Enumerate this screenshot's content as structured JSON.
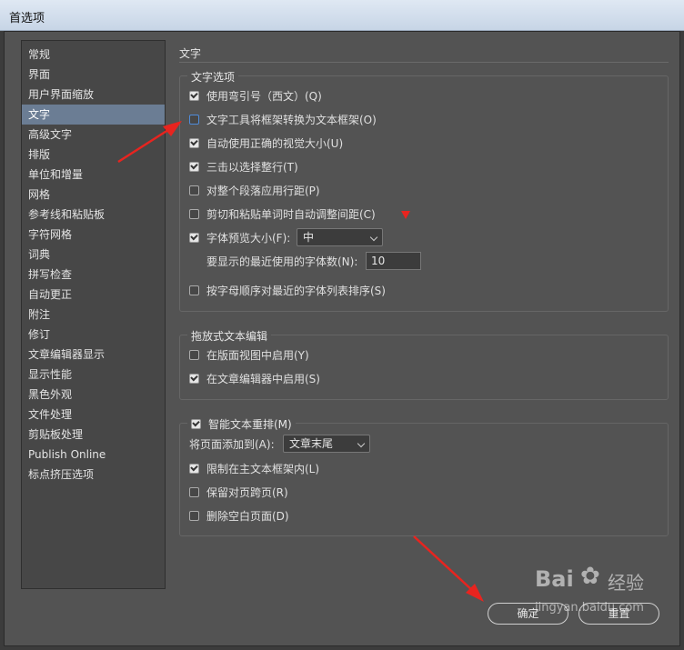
{
  "window": {
    "title": "首选项"
  },
  "sidebar": {
    "items": [
      {
        "label": "常规"
      },
      {
        "label": "界面"
      },
      {
        "label": "用户界面缩放"
      },
      {
        "label": "文字"
      },
      {
        "label": "高级文字"
      },
      {
        "label": "排版"
      },
      {
        "label": "单位和增量"
      },
      {
        "label": "网格"
      },
      {
        "label": "参考线和粘贴板"
      },
      {
        "label": "字符网格"
      },
      {
        "label": "词典"
      },
      {
        "label": "拼写检查"
      },
      {
        "label": "自动更正"
      },
      {
        "label": "附注"
      },
      {
        "label": "修订"
      },
      {
        "label": "文章编辑器显示"
      },
      {
        "label": "显示性能"
      },
      {
        "label": "黑色外观"
      },
      {
        "label": "文件处理"
      },
      {
        "label": "剪贴板处理"
      },
      {
        "label": "Publish Online"
      },
      {
        "label": "标点挤压选项"
      }
    ],
    "selected": "文字"
  },
  "section": {
    "title": "文字"
  },
  "type_options": {
    "legend": "文字选项",
    "items": [
      {
        "label": "使用弯引号（西文）(Q)",
        "checked": true
      },
      {
        "label": "文字工具将框架转换为文本框架(O)",
        "checked": false
      },
      {
        "label": "自动使用正确的视觉大小(U)",
        "checked": true
      },
      {
        "label": "三击以选择整行(T)",
        "checked": true
      },
      {
        "label": "对整个段落应用行距(P)",
        "checked": false
      },
      {
        "label": "剪切和粘贴单词时自动调整间距(C)",
        "checked": false
      },
      {
        "label": "字体预览大小(F):",
        "checked": true
      },
      {
        "label": "按字母顺序对最近的字体列表排序(S)",
        "checked": false
      }
    ],
    "font_preview_size": "中",
    "recent_fonts_label": "要显示的最近使用的字体数(N):",
    "recent_fonts_value": "10"
  },
  "drag_drop": {
    "legend": "拖放式文本编辑",
    "items": [
      {
        "label": "在版面视图中启用(Y)",
        "checked": false
      },
      {
        "label": "在文章编辑器中启用(S)",
        "checked": true
      }
    ]
  },
  "smart_reflow": {
    "legend": "智能文本重排(M)",
    "checked": true,
    "add_pages_label": "将页面添加到(A):",
    "add_pages_value": "文章末尾",
    "items": [
      {
        "label": "限制在主文本框架内(L)",
        "checked": true
      },
      {
        "label": "保留对页跨页(R)",
        "checked": false
      },
      {
        "label": "删除空白页面(D)",
        "checked": false
      }
    ]
  },
  "buttons": {
    "ok": "确定",
    "reset": "重置"
  },
  "watermark": {
    "brand": "Bai",
    "brand2": "经验",
    "url": "jingyan.baidu.com"
  },
  "colors": {
    "annotation": "#e8241f",
    "selected": "#6b7d94",
    "background": "#535353"
  }
}
